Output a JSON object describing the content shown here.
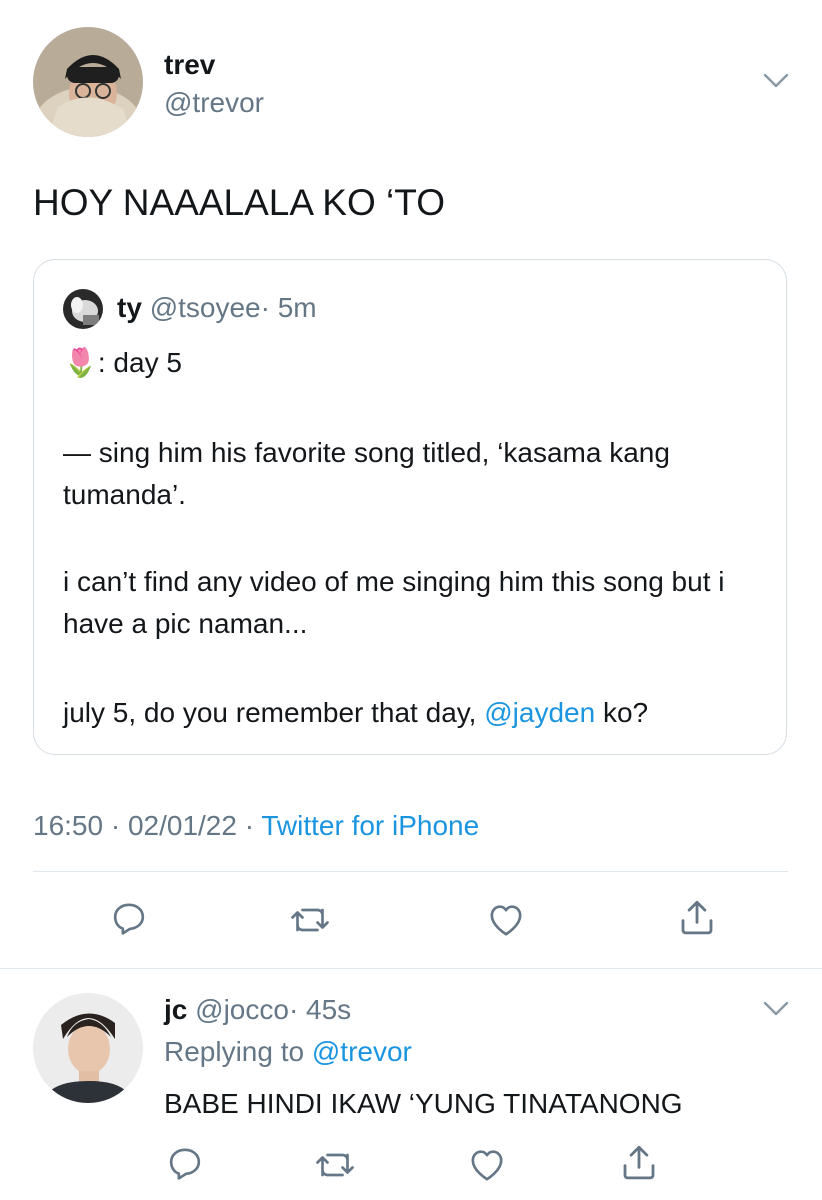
{
  "tweet": {
    "author_name": "trev",
    "author_handle": "@trevor",
    "text": "HOY NAAALALA KO ‘TO",
    "timestamp": "16:50 · 02/01/22 ·",
    "source": "Twitter for iPhone"
  },
  "quoted": {
    "author_name": "ty",
    "author_handle": "@tsoyee",
    "time": "· 5m",
    "emoji": "🌷",
    "line1": ": day 5",
    "para1": "— sing him his favorite song titled, ‘kasama kang tumanda’.",
    "para2": "i can’t find any video of me singing him this song but i have a pic naman...",
    "para3_before": "july 5, do you remember that day, ",
    "para3_mention": "@jayden",
    "para3_after": " ko?"
  },
  "reply": {
    "author_name": "jc",
    "author_handle": "@jocco",
    "time": "· 45s",
    "replying_prefix": "Replying to ",
    "replying_handle": "@trevor",
    "text": "BABE HINDI IKAW ‘YUNG TINATANONG"
  },
  "icons": [
    "reply-icon",
    "retweet-icon",
    "like-icon",
    "share-icon",
    "chevron-down-icon"
  ],
  "colors": {
    "accent": "#1b95e0",
    "secondary_text": "#657786",
    "divider": "#e1e8ed"
  }
}
